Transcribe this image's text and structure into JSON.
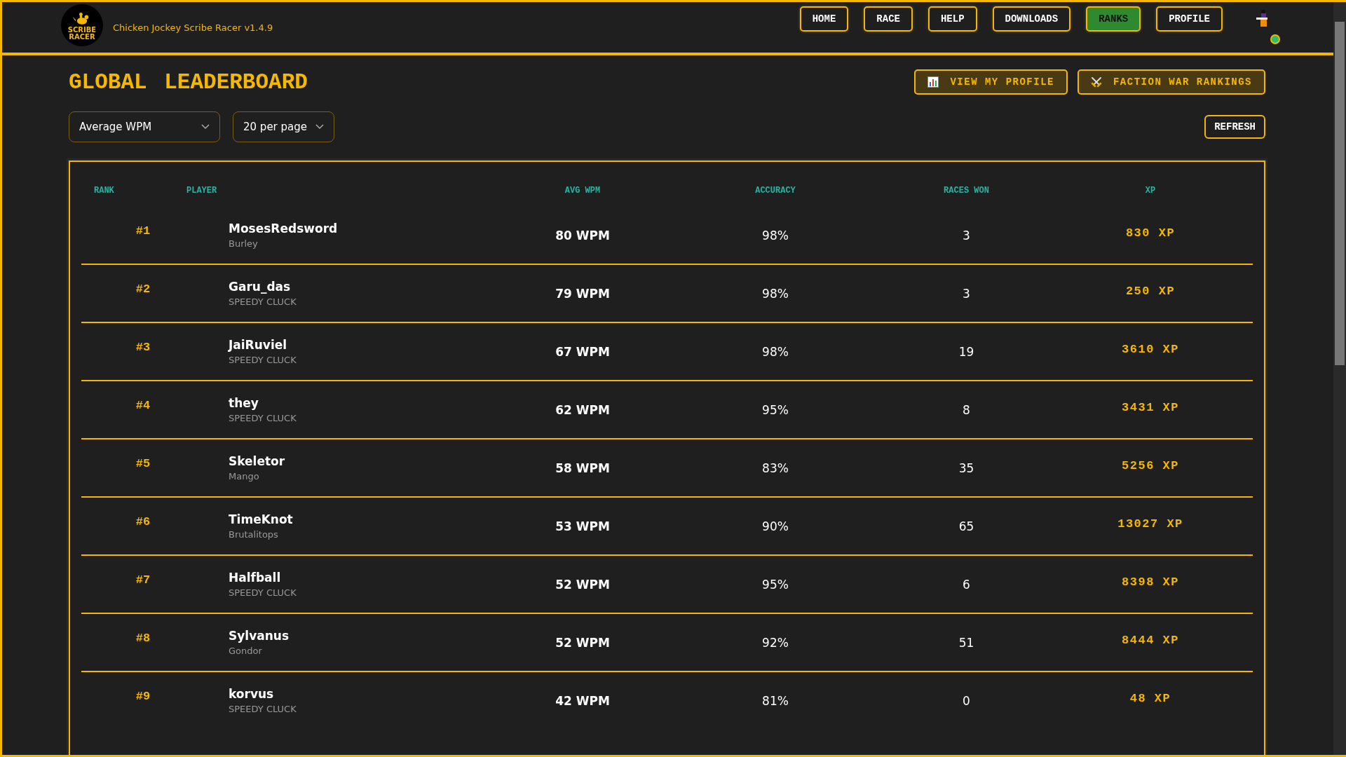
{
  "header": {
    "logo_lines": [
      "SCRIBE",
      "RACER"
    ],
    "app_title": "Chicken Jockey Scribe Racer v1.4.9",
    "nav": [
      {
        "label": "HOME",
        "selected": false
      },
      {
        "label": "RACE",
        "selected": false
      },
      {
        "label": "HELP",
        "selected": false
      },
      {
        "label": "DOWNLOADS",
        "selected": false
      },
      {
        "label": "RANKS",
        "selected": true
      },
      {
        "label": "PROFILE",
        "selected": false
      }
    ],
    "user_online": true
  },
  "page": {
    "title": "GLOBAL LEADERBOARD",
    "actions": [
      {
        "label": "VIEW MY PROFILE",
        "kind": "chart"
      },
      {
        "label": "FACTION WAR RANKINGS",
        "kind": "swords"
      }
    ],
    "sort_select": "Average WPM",
    "page_size_select": "20 per page",
    "refresh": "REFRESH"
  },
  "table": {
    "columns": [
      "RANK",
      "PLAYER",
      "AVG WPM",
      "ACCURACY",
      "RACES WON",
      "XP"
    ],
    "rows": [
      {
        "rank": "#1",
        "player": "MosesRedsword",
        "faction": "Burley",
        "wpm": "80 WPM",
        "accuracy": "98%",
        "races_won": "3",
        "xp": "830 XP"
      },
      {
        "rank": "#2",
        "player": "Garu_das",
        "faction": "SPEEDY CLUCK",
        "wpm": "79 WPM",
        "accuracy": "98%",
        "races_won": "3",
        "xp": "250 XP"
      },
      {
        "rank": "#3",
        "player": "JaiRuviel",
        "faction": "SPEEDY CLUCK",
        "wpm": "67 WPM",
        "accuracy": "98%",
        "races_won": "19",
        "xp": "3610 XP"
      },
      {
        "rank": "#4",
        "player": "they",
        "faction": "SPEEDY CLUCK",
        "wpm": "62 WPM",
        "accuracy": "95%",
        "races_won": "8",
        "xp": "3431 XP"
      },
      {
        "rank": "#5",
        "player": "Skeletor",
        "faction": "Mango",
        "wpm": "58 WPM",
        "accuracy": "83%",
        "races_won": "35",
        "xp": "5256 XP"
      },
      {
        "rank": "#6",
        "player": "TimeKnot",
        "faction": "Brutalitops",
        "wpm": "53 WPM",
        "accuracy": "90%",
        "races_won": "65",
        "xp": "13027 XP"
      },
      {
        "rank": "#7",
        "player": "Halfball",
        "faction": "SPEEDY CLUCK",
        "wpm": "52 WPM",
        "accuracy": "95%",
        "races_won": "6",
        "xp": "8398 XP"
      },
      {
        "rank": "#8",
        "player": "Sylvanus",
        "faction": "Gondor",
        "wpm": "52 WPM",
        "accuracy": "92%",
        "races_won": "51",
        "xp": "8444 XP"
      },
      {
        "rank": "#9",
        "player": "korvus",
        "faction": "SPEEDY CLUCK",
        "wpm": "42 WPM",
        "accuracy": "81%",
        "races_won": "0",
        "xp": "48 XP"
      }
    ]
  }
}
